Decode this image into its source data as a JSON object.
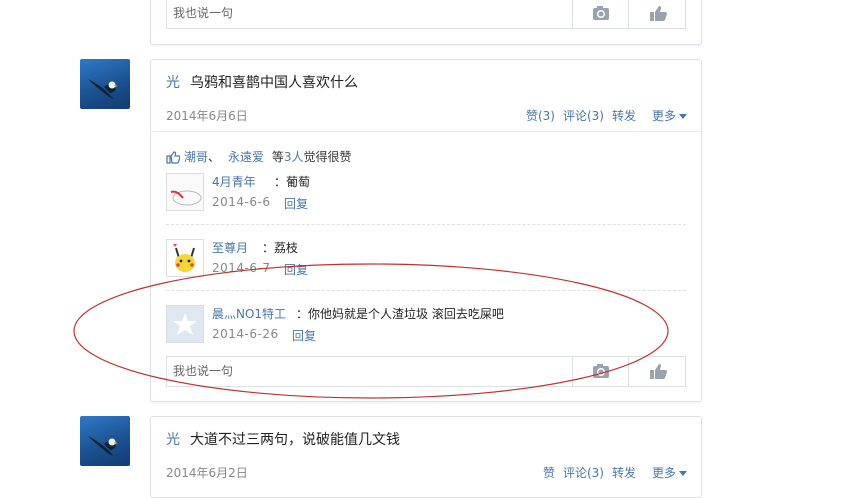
{
  "reply_placeholder": "我也说一句",
  "posts": [
    {
      "author": "光",
      "content": "乌鸦和喜鹊中国人喜欢什么",
      "date": "2014年6月6日",
      "actions": {
        "like": "赞(3)",
        "comment": "评论(3)",
        "share": "转发",
        "more": "更多"
      },
      "likes": {
        "names": [
          "潮哥",
          "永遠爱"
        ],
        "separator": "、",
        "prefix": "等",
        "count": "3人",
        "suffix": "觉得很赞"
      },
      "comments": [
        {
          "name": "4月青年",
          "text": "：葡萄",
          "date": "2014-6-6",
          "reply": "回复"
        },
        {
          "name": "至尊月",
          "text": "：荔枝",
          "date": "2014-6-7",
          "reply": "回复"
        },
        {
          "name": "晨灬NO1特工",
          "text": "：你他妈就是个人渣垃圾 滚回去吃屎吧",
          "date": "2014-6-26",
          "reply": "回复"
        }
      ]
    },
    {
      "author": "光",
      "content": "大道不过三两句，说破能值几文钱",
      "date": "2014年6月2日",
      "actions": {
        "like": "赞",
        "comment": "评论(3)",
        "share": "转发",
        "more": "更多"
      }
    }
  ],
  "icons": {
    "camera": "camera-icon",
    "thumb": "thumbs-up-icon"
  },
  "colors": {
    "link": "#4a76a8",
    "annotation": "#c0302f"
  }
}
